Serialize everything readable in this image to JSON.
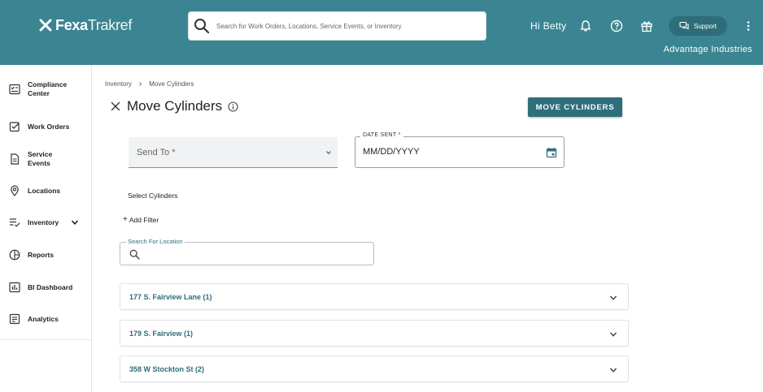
{
  "header": {
    "logo_bold": "Fexa",
    "logo_light": "Trakref",
    "search_placeholder": "Search for Work Orders, Locations, Service Events, or Inventory",
    "greeting": "Hi Betty",
    "support_label": "Support",
    "company": "Advantage Industries",
    "icons": [
      "bell-icon",
      "help-circle-icon",
      "gift-icon",
      "chat-icon",
      "more-vertical-icon"
    ]
  },
  "sidebar": {
    "items": [
      {
        "label": "Compliance Center",
        "icon": "compliance-icon"
      },
      {
        "label": "Work Orders",
        "icon": "checkbox-icon"
      },
      {
        "label": "Service Events",
        "icon": "document-icon"
      },
      {
        "label": "Locations",
        "icon": "map-pin-icon"
      },
      {
        "label": "Inventory",
        "icon": "list-check-icon",
        "expandable": true
      },
      {
        "label": "Reports",
        "icon": "pie-chart-icon"
      },
      {
        "label": "BI Dashboard",
        "icon": "bar-chart-icon"
      },
      {
        "label": "Analytics",
        "icon": "analytics-icon"
      }
    ]
  },
  "breadcrumb": {
    "items": [
      "Inventory",
      "Move Cylinders"
    ],
    "separator": "›"
  },
  "page": {
    "title": "Move Cylinders",
    "primary_button": "MOVE CYLINDERS",
    "accent_color": "#2f6f7c",
    "header_color": "#3b8593"
  },
  "form": {
    "send_to": {
      "label": "Send To *",
      "value": ""
    },
    "date_sent": {
      "label": "DATE SENT *",
      "placeholder": "MM/DD/YYYY",
      "value": ""
    },
    "select_cylinders_label": "Select Cylinders",
    "add_filter_label": "Add Filter",
    "location_search": {
      "label": "Search For Location",
      "value": ""
    }
  },
  "locations": [
    {
      "name": "177 S. Fairview Lane (1)",
      "expanded": false
    },
    {
      "name": "179 S. Fairview (1)",
      "expanded": false
    },
    {
      "name": "358 W Stockton St (2)",
      "expanded": false
    }
  ]
}
